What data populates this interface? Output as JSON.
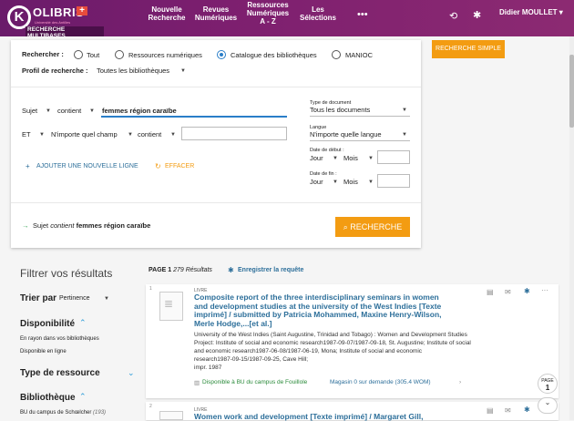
{
  "topbar": {
    "logo": {
      "name": "OLIBRIS",
      "letter": "K",
      "plus": "+",
      "sub": "RECHERCHE MULTIBASES",
      "tiny": "Université des Antilles"
    },
    "nav": [
      {
        "line1": "Nouvelle",
        "line2": "Recherche"
      },
      {
        "line1": "Revues",
        "line2": "Numériques"
      },
      {
        "line1": "Ressources",
        "line2": "Numériques",
        "line3": "A - Z"
      },
      {
        "line1": "Les",
        "line2": "Sélections"
      }
    ],
    "user": "Didier MOULLET ▾",
    "colors": {
      "bar": "#7d1f6f",
      "accent": "#f39c12",
      "link": "#2d6f9a"
    }
  },
  "search": {
    "rechercher_label": "Rechercher :",
    "scopes": [
      "Tout",
      "Ressources numériques",
      "Catalogue des bibliothèques",
      "MANIOC"
    ],
    "selected_scope": "Catalogue des bibliothèques",
    "profile_label": "Profil de recherche :",
    "profile_value": "Toutes les bibliothèques",
    "simple_button": "RECHERCHE SIMPLE",
    "row1": {
      "field": "Sujet",
      "op": "contient",
      "value": "femmes région caraïbe"
    },
    "row2": {
      "bool": "ET",
      "field": "N'importe quel champ",
      "op": "contient",
      "value": ""
    },
    "add_line": "AJOUTER UNE NOUVELLE LIGNE",
    "clear": "EFFACER",
    "doc_type": {
      "label": "Type de document",
      "value": "Tous les documents"
    },
    "language": {
      "label": "Langue",
      "value": "N'importe quelle langue"
    },
    "start_date": {
      "label": "Date de début :",
      "day": "Jour",
      "month": "Mois"
    },
    "end_date": {
      "label": "Date de fin :",
      "day": "Jour",
      "month": "Mois"
    },
    "summary_prefix": "Sujet",
    "summary_op": "contient",
    "summary_value": "femmes région caraïbe",
    "search_button": "RECHERCHE"
  },
  "sidebar": {
    "title": "Filtrer vos résultats",
    "sort_label": "Trier par",
    "sort_value": "Pertinence",
    "availability": "Disponibilité",
    "avail_items": [
      "En rayon dans vos bibliothèques",
      "Disponible en ligne"
    ],
    "resource_type": "Type de ressource",
    "library": "Bibliothèque",
    "library_items": [
      {
        "name": "BU du campus de Schœlcher",
        "count": "(193)"
      }
    ]
  },
  "results": {
    "page": "PAGE 1",
    "count": "279 Résultats",
    "save": "Enregistrer la requête",
    "items": [
      {
        "num": "1",
        "type": "LIVRE",
        "title": "Composite report of the three interdisciplinary seminars in women and development studies at the university of the West Indies [Texte imprimé] / submitted by Patricia Mohammed, Maxine Henry-Wilson, Merle Hodge,...[et al.]",
        "desc1": "University of the West Indies (Saint Augustine, Trinidad and Tobago) : Women and Development Studies",
        "desc2": "Project: Institute of social and economic research1987-09-07/1987-09-18, St. Augustine; Institute of social",
        "desc3": "and economic research1987-06-08/1987-06-19, Mona; Institute of social and economic",
        "desc4": "research1987-09-15/1987-09-25, Cave Hill;",
        "desc5": "impr. 1987",
        "avail": "Disponible à BU du campus de Fouillole",
        "avail_detail": "Magasin 0 sur demande (305.4 WOM)"
      },
      {
        "num": "2",
        "type": "LIVRE",
        "title": "Women work and development [Texte imprimé] / Margaret Gill,"
      }
    ],
    "page_badge": {
      "label": "PAGE",
      "num": "1"
    }
  }
}
